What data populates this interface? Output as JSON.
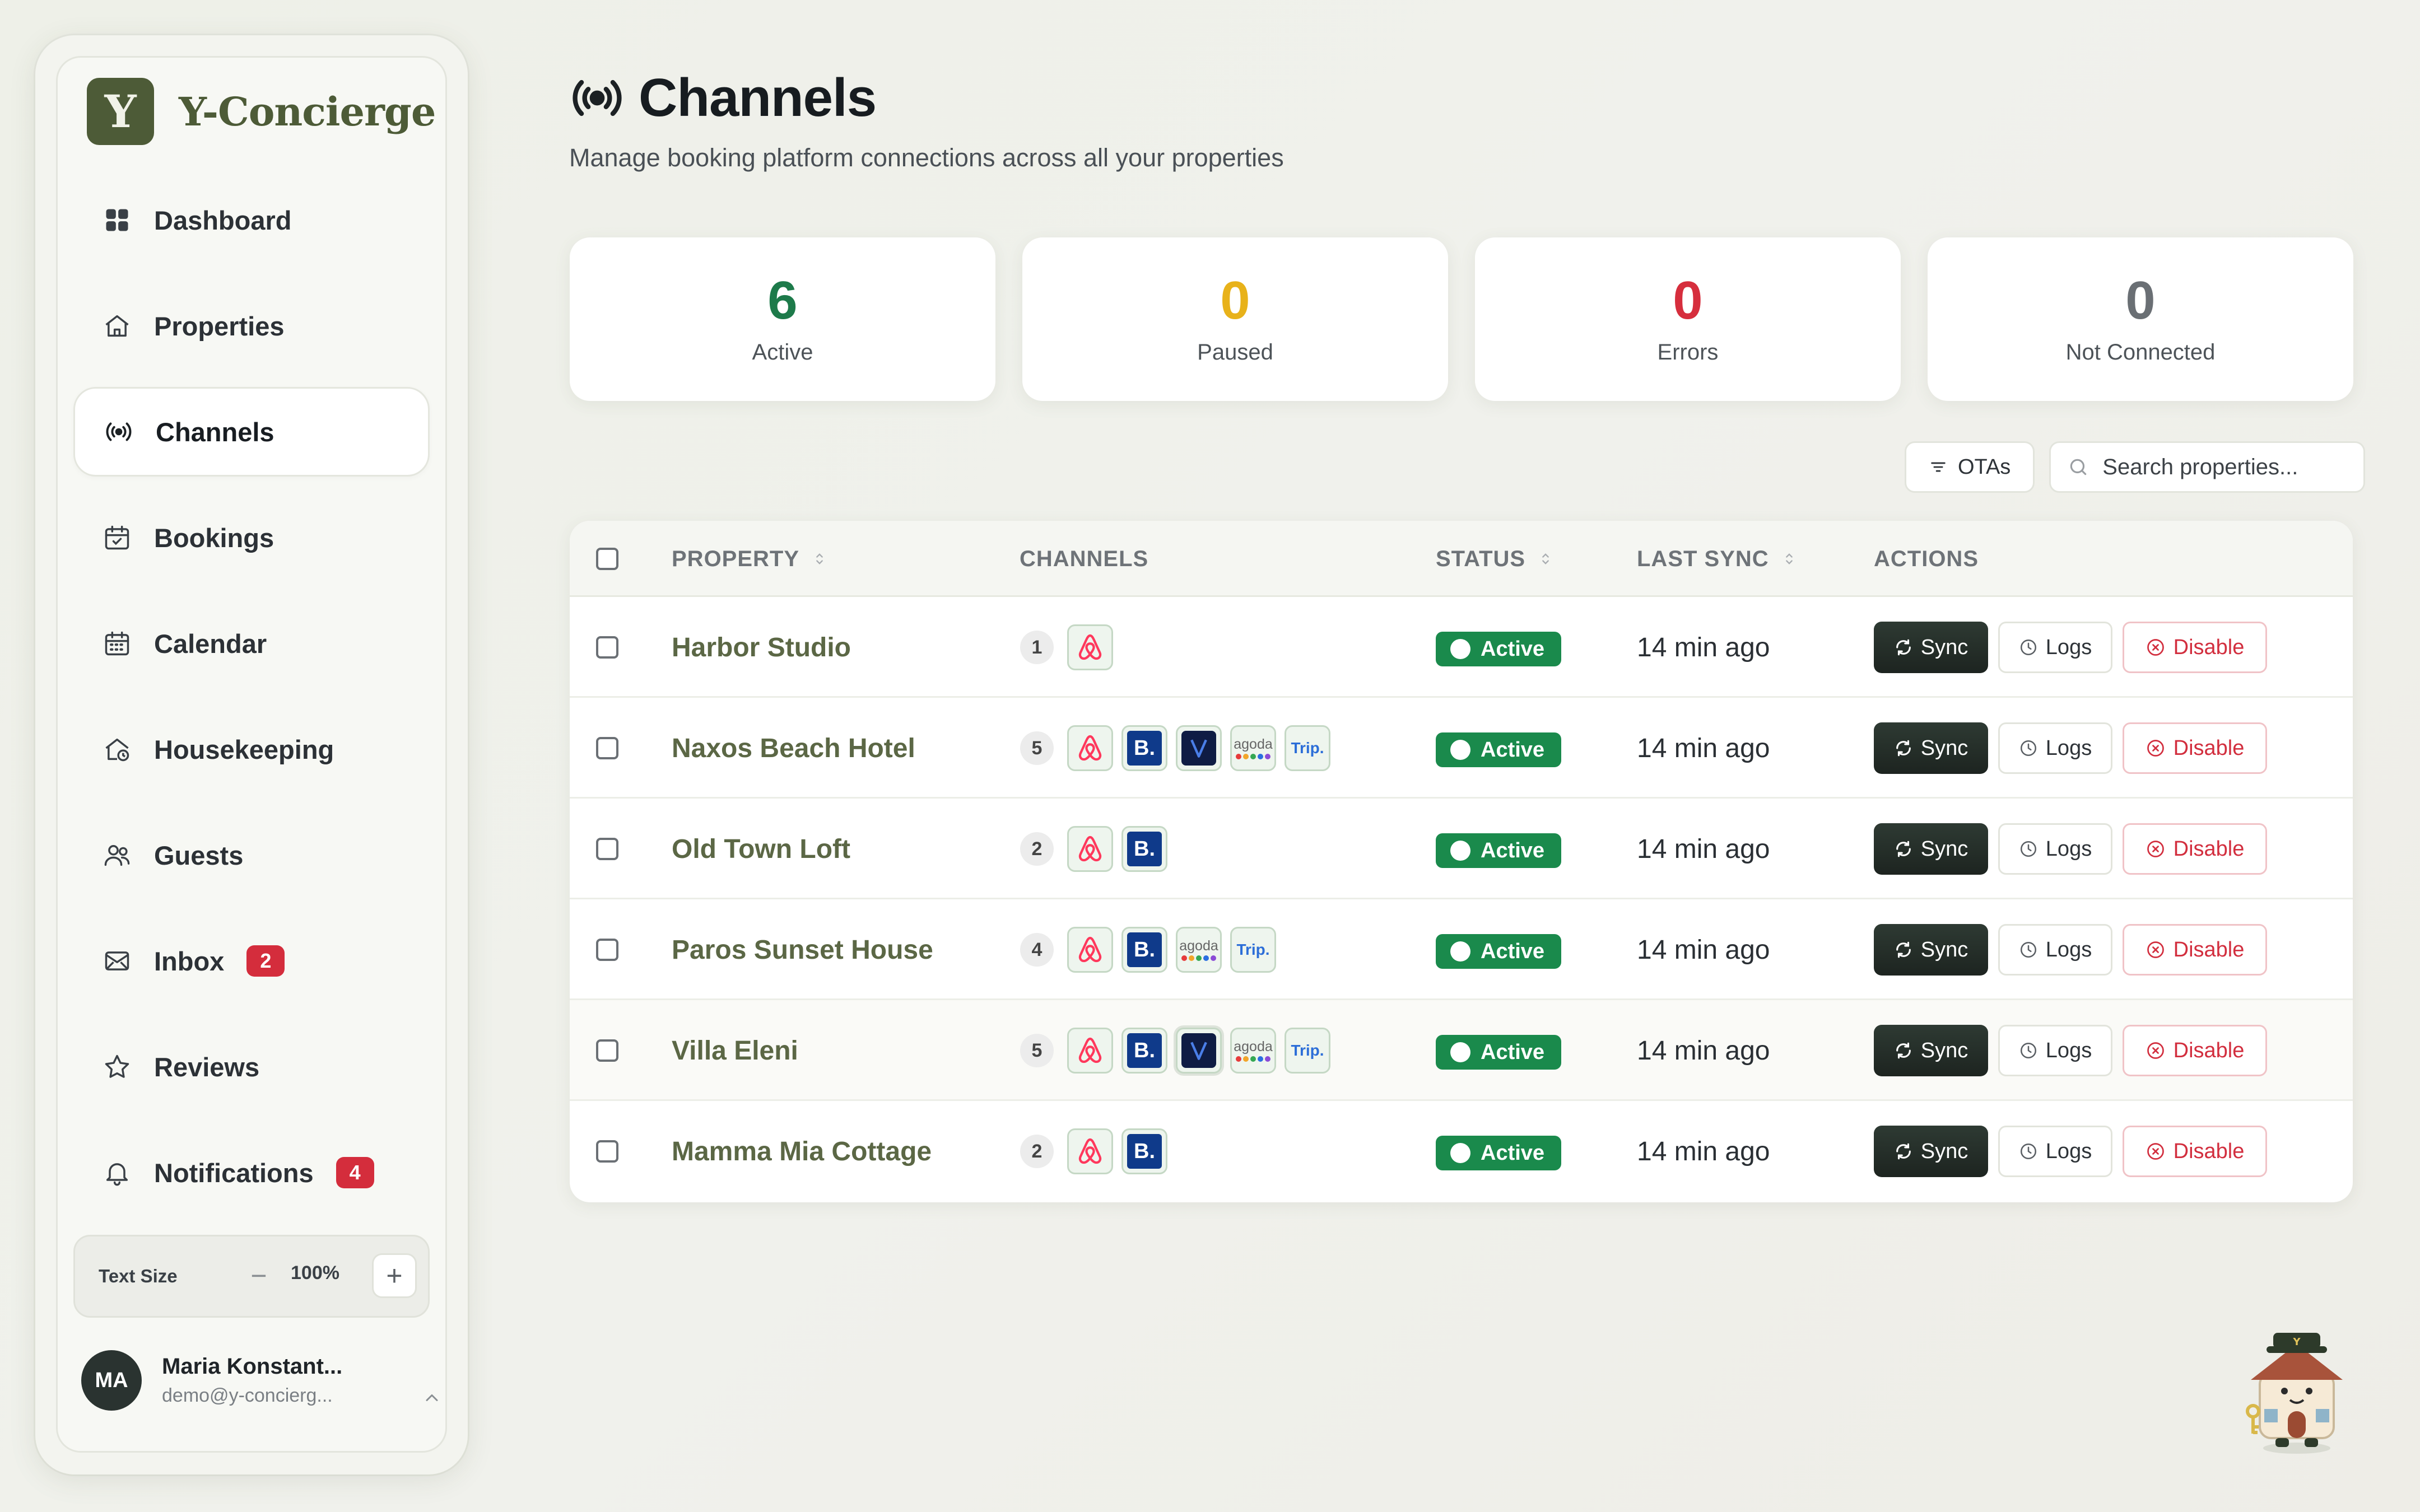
{
  "brand": {
    "logo_letter": "Y",
    "name": "Y-Concierge"
  },
  "sidebar": {
    "items": [
      {
        "label": "Dashboard",
        "icon": "grid-icon",
        "active": false
      },
      {
        "label": "Properties",
        "icon": "house-icon",
        "active": false
      },
      {
        "label": "Channels",
        "icon": "broadcast-icon",
        "active": true
      },
      {
        "label": "Bookings",
        "icon": "calendar-check-icon",
        "active": false
      },
      {
        "label": "Calendar",
        "icon": "calendar-grid-icon",
        "active": false
      },
      {
        "label": "Housekeeping",
        "icon": "house-clock-icon",
        "active": false
      },
      {
        "label": "Guests",
        "icon": "users-icon",
        "active": false
      },
      {
        "label": "Inbox",
        "icon": "mail-icon",
        "active": false,
        "badge": "2"
      },
      {
        "label": "Reviews",
        "icon": "star-icon",
        "active": false
      },
      {
        "label": "Notifications",
        "icon": "bell-icon",
        "active": false,
        "badge": "4"
      }
    ],
    "text_size": {
      "label": "Text Size",
      "value": "100%"
    },
    "user": {
      "initials": "MA",
      "name": "Maria Konstant...",
      "email": "demo@y-concierg..."
    }
  },
  "page": {
    "title": "Channels",
    "subtitle": "Manage booking platform connections across all your properties"
  },
  "stats": [
    {
      "value": "6",
      "label": "Active",
      "color": "#1d7a4a"
    },
    {
      "value": "0",
      "label": "Paused",
      "color": "#e8b21a"
    },
    {
      "value": "0",
      "label": "Errors",
      "color": "#d62e3d"
    },
    {
      "value": "0",
      "label": "Not Connected",
      "color": "#6a6f74"
    }
  ],
  "toolbar": {
    "filter_label": "OTAs",
    "search_placeholder": "Search properties..."
  },
  "table": {
    "headers": {
      "property": "PROPERTY",
      "channels": "CHANNELS",
      "status": "STATUS",
      "last_sync": "LAST SYNC",
      "actions": "ACTIONS"
    },
    "rows": [
      {
        "property": "Harbor Studio",
        "count": "1",
        "channels": [
          "airbnb"
        ],
        "status": "Active",
        "last_sync": "14 min ago"
      },
      {
        "property": "Naxos Beach Hotel",
        "count": "5",
        "channels": [
          "airbnb",
          "booking",
          "vrbo",
          "agoda",
          "trip"
        ],
        "status": "Active",
        "last_sync": "14 min ago"
      },
      {
        "property": "Old Town Loft",
        "count": "2",
        "channels": [
          "airbnb",
          "booking"
        ],
        "status": "Active",
        "last_sync": "14 min ago"
      },
      {
        "property": "Paros Sunset House",
        "count": "4",
        "channels": [
          "airbnb",
          "booking",
          "agoda",
          "trip"
        ],
        "status": "Active",
        "last_sync": "14 min ago"
      },
      {
        "property": "Villa Eleni",
        "count": "5",
        "channels": [
          "airbnb",
          "booking",
          "vrbo",
          "agoda",
          "trip"
        ],
        "status": "Active",
        "last_sync": "14 min ago"
      },
      {
        "property": "Mamma Mia Cottage",
        "count": "2",
        "channels": [
          "airbnb",
          "booking"
        ],
        "status": "Active",
        "last_sync": "14 min ago"
      }
    ],
    "action_labels": {
      "sync": "Sync",
      "logs": "Logs",
      "disable": "Disable"
    }
  },
  "channel_labels": {
    "booking": "B.",
    "agoda": "agoda",
    "trip": "Trip."
  }
}
